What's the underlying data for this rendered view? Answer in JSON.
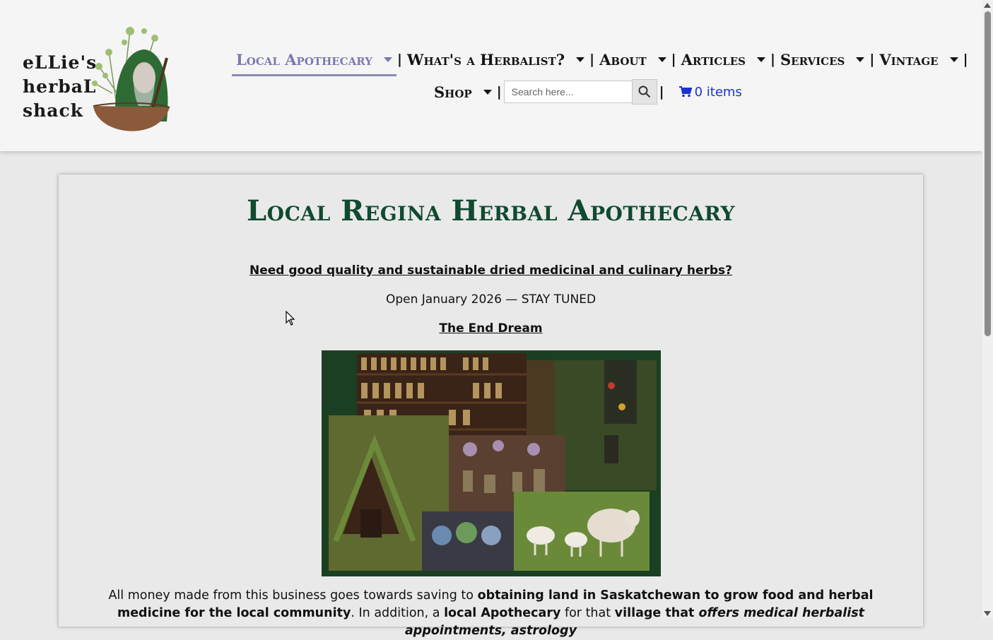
{
  "logo": {
    "lines": [
      "eLLie's",
      "herbaL",
      "shack"
    ]
  },
  "nav": {
    "items": [
      {
        "label": "Local Apothecary",
        "active": true
      },
      {
        "label": "What's a Herbalist?"
      },
      {
        "label": "About"
      },
      {
        "label": "Articles"
      },
      {
        "label": "Services"
      },
      {
        "label": "Vintage"
      },
      {
        "label": "Shop"
      }
    ],
    "separator": "|"
  },
  "search": {
    "placeholder": "Search here..."
  },
  "cart": {
    "label": "0 items"
  },
  "main": {
    "title": "Local Regina Herbal Apothecary",
    "question": "Need good quality and sustainable dried medicinal and culinary herbs?",
    "open_text": "Open January 2026 — STAY TUNED",
    "dream_heading": "The End Dream",
    "para": {
      "t1": "All money made from this business goes towards saving to ",
      "b1": "obtaining land in Saskatchewan to grow food and herbal medicine for the local community",
      "t2": ". In addition, a ",
      "b2": "local Apothecary",
      "t3": " for that ",
      "b3": "village that ",
      "bi1": "offers medical herbalist appointments, astrology"
    }
  },
  "colors": {
    "title": "#104a30",
    "nav_active": "#7a7ab0",
    "cart": "#1a33d0",
    "collage_bg": "#1b3f22"
  }
}
